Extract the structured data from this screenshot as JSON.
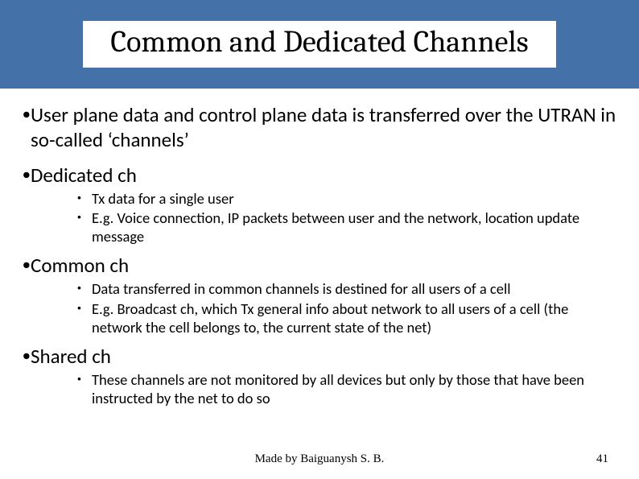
{
  "title": "Common and Dedicated Channels",
  "intro": "User plane data and control plane data is transferred over the UTRAN in so-called ‘channels’",
  "sections": [
    {
      "heading": "Dedicated ch",
      "items": [
        "Tx data for a single user",
        "E.g. Voice connection, IP packets between user and the network, location update message"
      ]
    },
    {
      "heading": "Common ch",
      "items": [
        "Data transferred in common channels is destined for all users of a cell",
        "E.g. Broadcast ch, which Tx general info about network to all users of a cell (the network the cell belongs to, the current state of the net)"
      ]
    },
    {
      "heading": "Shared ch",
      "items": [
        "These channels are not monitored by all devices but only by those that have been instructed by the net to do so"
      ]
    }
  ],
  "footer": {
    "credit": "Made by Baiguanysh S. B.",
    "page": "41"
  }
}
